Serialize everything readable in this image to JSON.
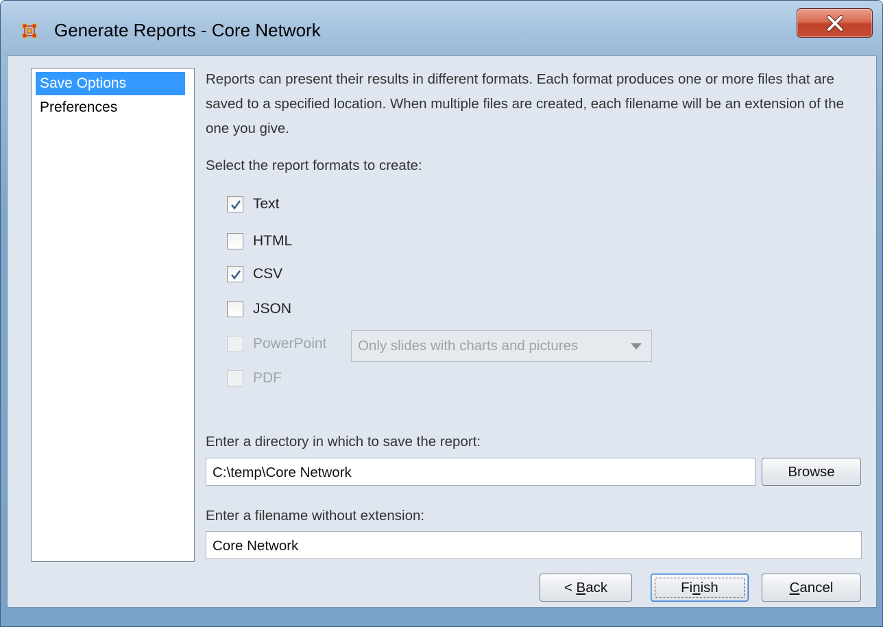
{
  "window": {
    "title": "Generate Reports - Core Network"
  },
  "nav": {
    "items": [
      {
        "label": "Save Options",
        "selected": true
      },
      {
        "label": "Preferences",
        "selected": false
      }
    ]
  },
  "description": "Reports can present their results in different formats. Each format produces one or more files that are saved to a specified location. When multiple files are created, each filename will be an extension of the one you give.",
  "formats": {
    "prompt": "Select the report formats to create:",
    "items": [
      {
        "label": "Text",
        "checked": true,
        "enabled": true
      },
      {
        "label": "HTML",
        "checked": false,
        "enabled": true
      },
      {
        "label": "CSV",
        "checked": true,
        "enabled": true
      },
      {
        "label": "JSON",
        "checked": false,
        "enabled": true
      },
      {
        "label": "PowerPoint",
        "checked": false,
        "enabled": false
      },
      {
        "label": "PDF",
        "checked": false,
        "enabled": false
      }
    ],
    "powerpoint_option": "Only slides with charts and pictures"
  },
  "directory": {
    "label": "Enter a directory in which to save the report:",
    "value": "C:\\temp\\Core Network",
    "browse_label": "Browse"
  },
  "filename": {
    "label": "Enter a filename without extension:",
    "value": "Core Network"
  },
  "buttons": {
    "back": {
      "prefix": "< ",
      "mnemonic": "B",
      "rest": "ack"
    },
    "finish": {
      "prefix": "Fi",
      "mnemonic": "n",
      "rest": "ish"
    },
    "cancel": {
      "prefix": "",
      "mnemonic": "C",
      "rest": "ancel"
    }
  },
  "colors": {
    "selection": "#3399ff",
    "dialog_bg": "#dfe6ef",
    "close_button": "#c7432d"
  },
  "icons": {
    "app": "network-grid-icon",
    "close": "close-icon",
    "check": "checkmark-icon",
    "dropdown": "chevron-down-icon"
  }
}
